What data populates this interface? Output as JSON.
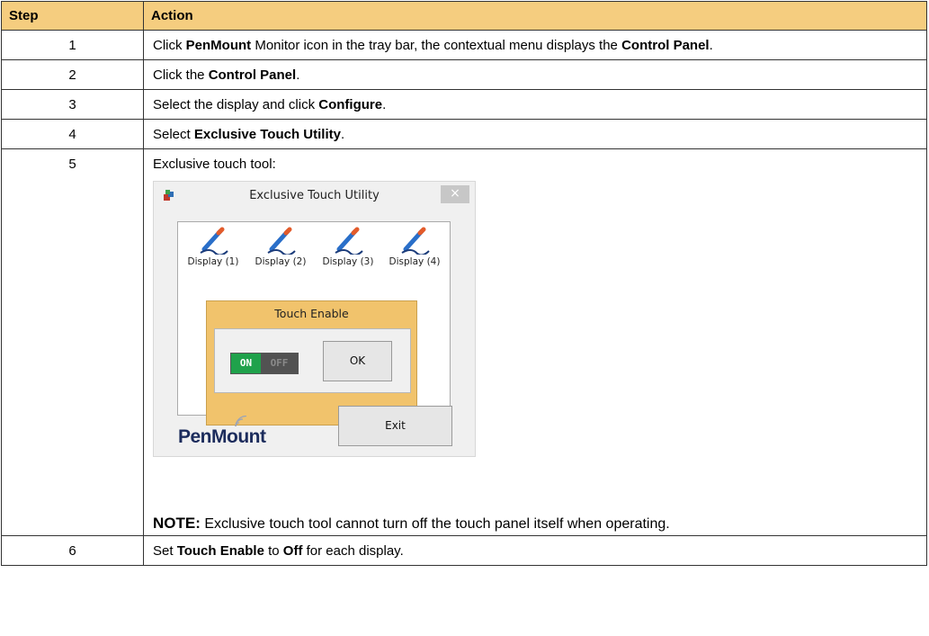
{
  "table": {
    "header": {
      "step": "Step",
      "action": "Action"
    },
    "rows": [
      {
        "step": "1",
        "parts": [
          "Click ",
          "PenMount",
          " Monitor icon in the tray bar, the contextual menu displays the ",
          "Control Panel",
          "."
        ]
      },
      {
        "step": "2",
        "parts": [
          "Click the ",
          "Control Panel",
          "."
        ]
      },
      {
        "step": "3",
        "parts": [
          "Select the display and click ",
          "Configure",
          "."
        ]
      },
      {
        "step": "4",
        "parts": [
          "Select ",
          "Exclusive Touch Utility",
          "."
        ]
      },
      {
        "step": "5",
        "intro": "Exclusive touch tool:",
        "note_label": "NOTE:",
        "note_text": " Exclusive touch tool cannot turn off the touch panel itself when operating."
      },
      {
        "step": "6",
        "parts": [
          "Set ",
          "Touch Enable",
          " to ",
          "Off",
          " for each display."
        ]
      }
    ]
  },
  "dialog": {
    "title": "Exclusive Touch Utility",
    "close_glyph": "×",
    "displays": [
      "Display (1)",
      "Display (2)",
      "Display (3)",
      "Display (4)"
    ],
    "touch_enable_title": "Touch Enable",
    "toggle_on": "ON",
    "toggle_off": "OFF",
    "toggle_state": "on",
    "ok_label": "OK",
    "logo_pen": "Pen",
    "logo_mount": "Mount",
    "exit_label": "Exit",
    "pen_icon": "pen-icon"
  },
  "colors": {
    "header_bg": "#f5cd7f",
    "touch_box": "#f1c36c",
    "toggle_on": "#1fa24b",
    "logo": "#1c2c5c"
  }
}
